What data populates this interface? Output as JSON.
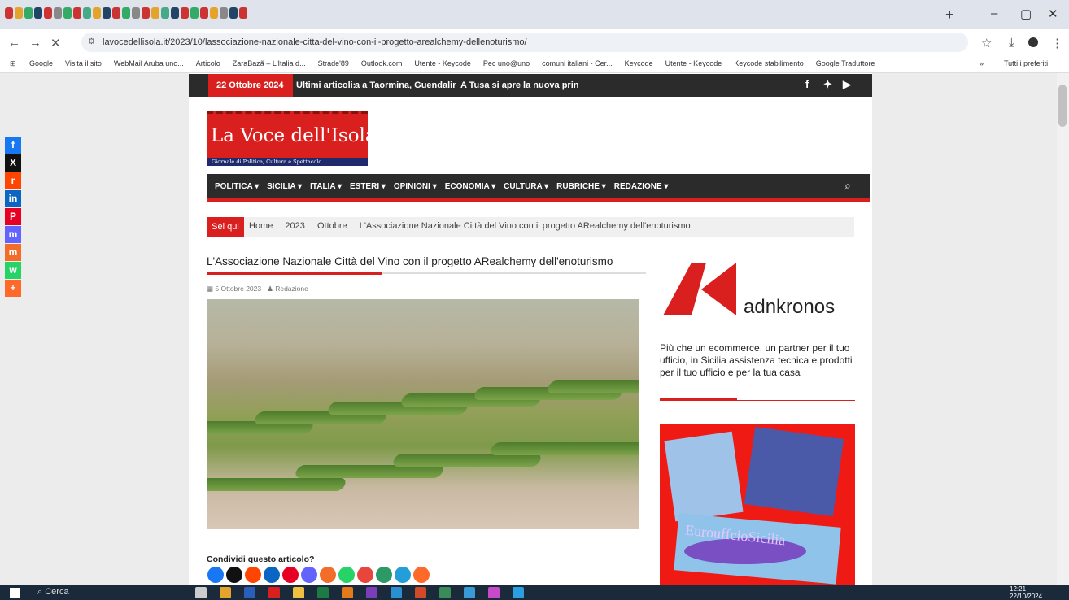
{
  "browser": {
    "url": "lavocedellisola.it/2023/10/lassociazione-nazionale-citta-del-vino-con-il-progetto-arealchemy-dellenoturismo/",
    "bookmarks": [
      "Google",
      "Visita il sito",
      "WebMail Aruba uno...",
      "Articolo",
      "ZaraBazã – L'Italia d...",
      "Strade'89",
      "Outlook.com",
      "Utente - Keycode",
      "Pec uno@uno",
      "comuni italiani - Cer...",
      "Keycode",
      "Utente - Keycode",
      "Keycode stabilimento",
      "Google Traduttore"
    ],
    "all_bookmarks": "Tutti i preferiti",
    "add_tab": "+"
  },
  "site": {
    "date": "22 Ottobre 2024",
    "latest_label": "Ultimi articoli:",
    "ticker_1": "a a Taormina, Guendalina",
    "ticker_2": "A Tusa si apre la nuova prin",
    "logo_name": "La Voce dell'Isola",
    "logo_sub": "Giornale di Politica, Cultura e Spettacolo",
    "menu": [
      "POLITICA ▾",
      "SICILIA ▾",
      "ITALIA ▾",
      "ESTERI ▾",
      "OPINIONI ▾",
      "ECONOMIA ▾",
      "CULTURA ▾",
      "RUBRICHE ▾",
      "REDAZIONE ▾"
    ]
  },
  "breadcrumb": {
    "label": "Sei qui",
    "items": [
      "Home",
      "2023",
      "Ottobre",
      "L'Associazione Nazionale Città del Vino con il progetto ARealchemy dell'enoturismo"
    ]
  },
  "article": {
    "title": "L'Associazione Nazionale Città del Vino con il progetto ARealchemy dell'enoturismo",
    "date": "5 Ottobre 2023",
    "author": "Redazione",
    "share_label": "Condividi questo articolo?"
  },
  "sidebar": {
    "adn_brand": "adnkronos",
    "ad_text": "Più che un ecommerce, un partner per il tuo ufficio, in Sicilia assistenza tecnica e prodotti per il tuo ufficio e per la tua casa",
    "ad2_name": "EurouffcioSicilia"
  },
  "taskbar": {
    "search": "Cerca",
    "time": "12:21",
    "date": "22/10/2024"
  },
  "colors": {
    "accent": "#d9201e",
    "dark": "#2b2b2b"
  }
}
